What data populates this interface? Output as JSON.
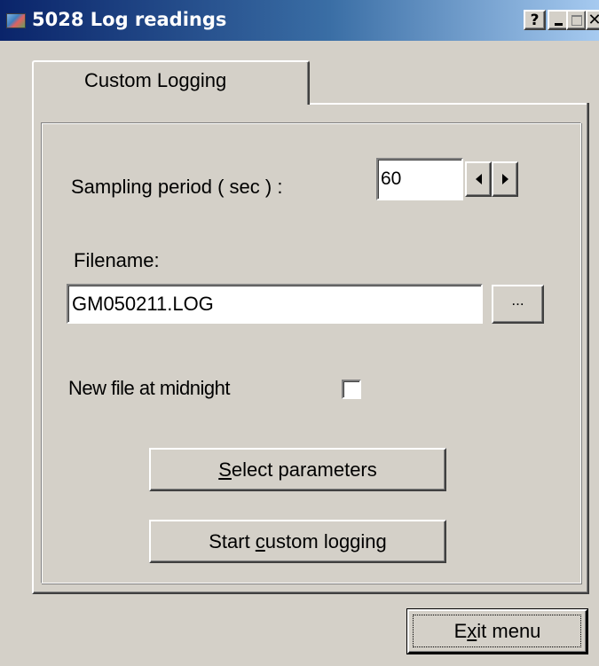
{
  "window": {
    "title": "5028 Log readings",
    "icon": "app-icon",
    "buttons": {
      "help": "?",
      "minimize": "minimize-icon",
      "maximize": "maximize-icon",
      "close": "close-icon"
    }
  },
  "tabs": [
    {
      "label": "Custom Logging",
      "selected": true
    }
  ],
  "form": {
    "sampling_label": "Sampling period ( sec ) :",
    "sampling_value": "60",
    "filename_label": "Filename:",
    "filename_value": "GM050211.LOG",
    "browse_label": "...",
    "midnight_label": "New file at midnight",
    "midnight_checked": false
  },
  "buttons": {
    "select_params": {
      "prefix": "",
      "accel": "S",
      "rest": "elect parameters"
    },
    "start_logging": {
      "prefix": "Start ",
      "accel": "c",
      "rest": "ustom logging"
    },
    "exit": {
      "prefix": "E",
      "accel": "x",
      "rest": "it menu"
    }
  },
  "colors": {
    "face": "#d4d0c8",
    "titlebar_start": "#0a246a",
    "titlebar_end": "#a6caf0"
  }
}
